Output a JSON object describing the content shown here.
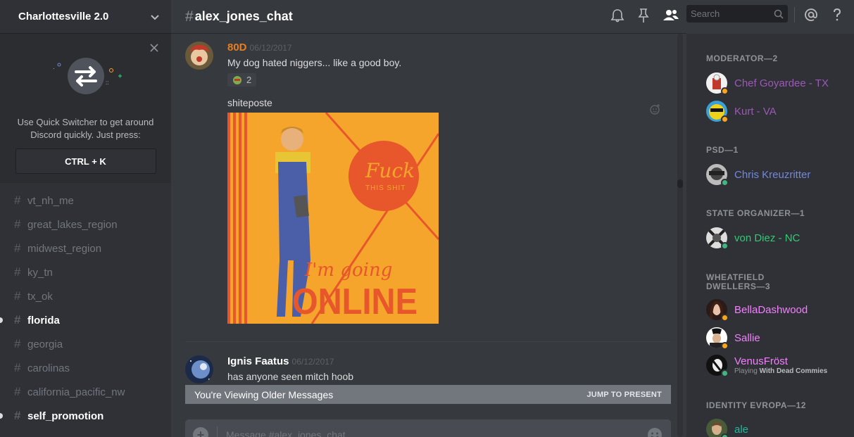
{
  "server": {
    "name": "Charlottesville 2.0"
  },
  "quick_switcher": {
    "text_line1": "Use Quick Switcher to get around",
    "text_line2": "Discord quickly. Just press:",
    "shortcut": "CTRL + K"
  },
  "channels": [
    {
      "name": "vt_nh_me",
      "unread": false
    },
    {
      "name": "great_lakes_region",
      "unread": false
    },
    {
      "name": "midwest_region",
      "unread": false
    },
    {
      "name": "ky_tn",
      "unread": false
    },
    {
      "name": "tx_ok",
      "unread": false
    },
    {
      "name": "florida",
      "unread": true
    },
    {
      "name": "georgia",
      "unread": false
    },
    {
      "name": "carolinas",
      "unread": false
    },
    {
      "name": "california_pacific_nw",
      "unread": false
    },
    {
      "name": "self_promotion",
      "unread": true
    }
  ],
  "chat": {
    "channel_hash": "#",
    "channel_name": "alex_jones_chat",
    "messages": [
      {
        "author": "80D",
        "author_color": "#e67e22",
        "timestamp": "06/12/2017",
        "text": "My dog hated niggers... like a good boy.",
        "reaction_count": "2",
        "second_text": "shiteposte",
        "image": {
          "script_line1": "Fuck",
          "script_line2": "THIS SHIT",
          "bottom_script": "I'm going",
          "bottom_big": "ONLINE"
        }
      },
      {
        "author": "Ignis Faatus",
        "author_color": "#ffffff",
        "timestamp": "06/12/2017",
        "text": "has anyone seen mitch hoob"
      }
    ],
    "older_bar": {
      "label": "You're Viewing Older Messages",
      "action": "JUMP TO PRESENT"
    },
    "composer": {
      "placeholder": "Message #alex_jones_chat"
    }
  },
  "header": {
    "search_placeholder": "Search"
  },
  "members": {
    "groups": [
      {
        "title": "MODERATOR—2",
        "members": [
          {
            "name": "Chef Goyardee - TX",
            "color": "#9b59b6",
            "status": "idle"
          },
          {
            "name": "Kurt - VA",
            "color": "#9b59b6",
            "status": "idle"
          }
        ]
      },
      {
        "title": "PSD—1",
        "members": [
          {
            "name": "Chris Kreuzritter",
            "color": "#7289da",
            "status": "online"
          }
        ]
      },
      {
        "title": "STATE ORGANIZER—1",
        "members": [
          {
            "name": "von Diez - NC",
            "color": "#2ecc71",
            "status": "online"
          }
        ]
      },
      {
        "title_line1": "WHEATFIELD",
        "title_line2": "DWELLERS—3",
        "members": [
          {
            "name": "BellaDashwood",
            "color": "#f47fff",
            "status": "idle"
          },
          {
            "name": "Sallie",
            "color": "#f47fff",
            "status": "idle"
          },
          {
            "name": "VenusFröst",
            "color": "#f47fff",
            "status": "online",
            "activity_prefix": "Playing",
            "activity": "With Dead Commies"
          }
        ]
      },
      {
        "title": "IDENTITY EVROPA—12",
        "members": [
          {
            "name": "ale",
            "color": "#1abc9c",
            "status": "online"
          }
        ]
      }
    ]
  }
}
